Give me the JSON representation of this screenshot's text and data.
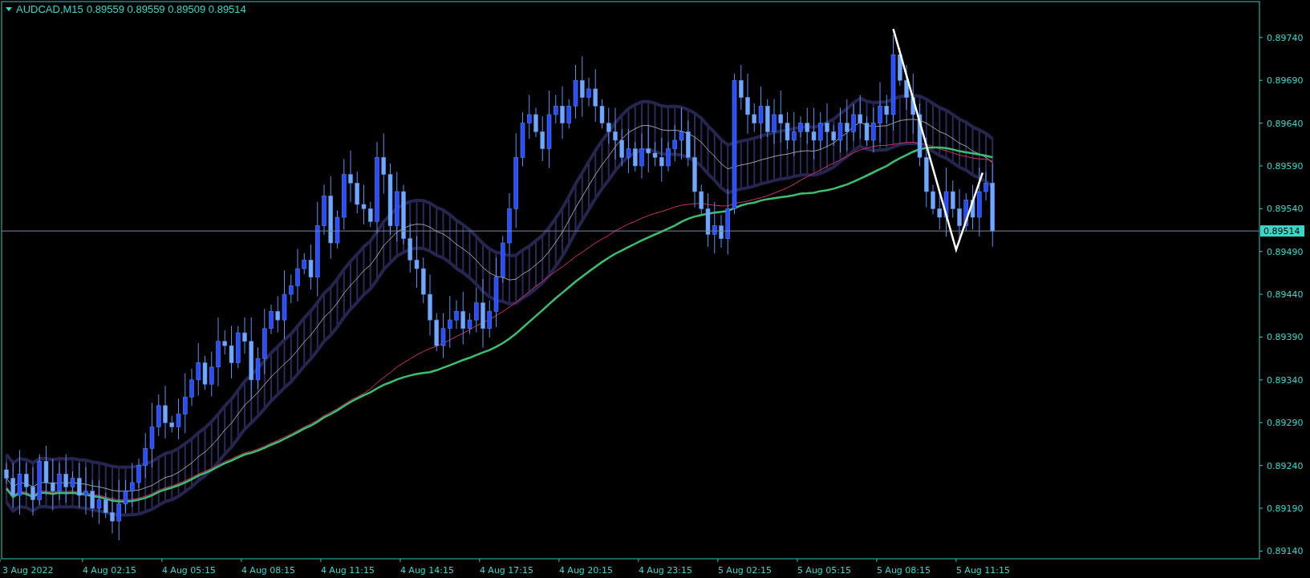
{
  "header": {
    "symbol": "AUDCAD,M15",
    "prices": "0.89559 0.89559 0.89509 0.89514"
  },
  "current_price": "0.89514",
  "price_axis": [
    "0.89740",
    "0.89690",
    "0.89640",
    "0.89590",
    "0.89540",
    "0.89490",
    "0.89440",
    "0.89390",
    "0.89340",
    "0.89290",
    "0.89240",
    "0.89190",
    "0.89140"
  ],
  "time_axis": [
    "3 Aug 2022",
    "4 Aug 02:15",
    "4 Aug 05:15",
    "4 Aug 08:15",
    "4 Aug 11:15",
    "4 Aug 14:15",
    "4 Aug 17:15",
    "4 Aug 20:15",
    "4 Aug 23:15",
    "5 Aug 02:15",
    "5 Aug 05:15",
    "5 Aug 08:15",
    "5 Aug 11:15"
  ]
}
